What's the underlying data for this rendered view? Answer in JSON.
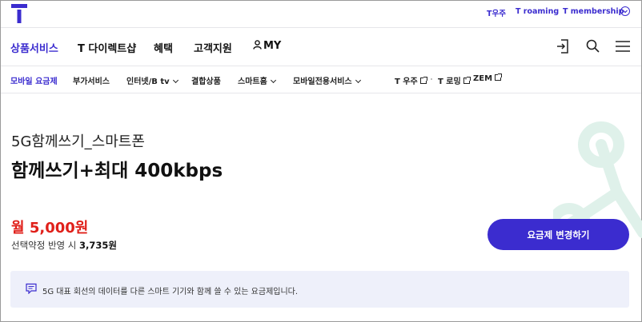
{
  "brand": {
    "logo_letter": "T",
    "accent": "#3b2ccf",
    "price_color": "#e0201a"
  },
  "utility_links": [
    "T우주",
    "T roaming",
    "T membership"
  ],
  "main_nav": {
    "items": [
      "상품서비스",
      "T 다이렉트샵",
      "혜택",
      "고객지원",
      "MY"
    ],
    "icons": [
      "login-icon",
      "search-icon",
      "menu-icon"
    ]
  },
  "sub_nav": {
    "items": [
      "모바일 요금제",
      "부가서비스",
      "인터넷/B tv",
      "결합상품",
      "스마트홈",
      "모바일전용서비스",
      "T 우주",
      "T 로밍",
      "ZEM"
    ]
  },
  "plan": {
    "category": "5G함께쓰기_스마트폰",
    "name": "함께쓰기+최대 400kbps",
    "price": "월 5,000원",
    "discount_label": "선택약정 반영 시",
    "discount_price": "3,735원",
    "change_button": "요금제 변경하기",
    "description": "5G 대표 회선의 데이터를 다른 스마트 기기와 함께 쓸 수 있는 요금제입니다."
  }
}
